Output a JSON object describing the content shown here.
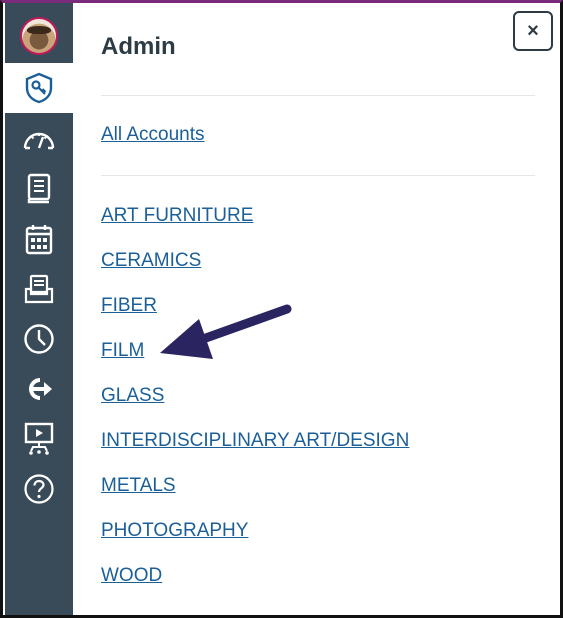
{
  "nav": {
    "items": [
      {
        "id": "avatar",
        "icon": "user-avatar"
      },
      {
        "id": "admin",
        "icon": "shield-key-icon",
        "active": true
      },
      {
        "id": "dashboard",
        "icon": "speedometer-icon"
      },
      {
        "id": "courses",
        "icon": "book-icon"
      },
      {
        "id": "calendar",
        "icon": "calendar-icon"
      },
      {
        "id": "inbox",
        "icon": "inbox-icon"
      },
      {
        "id": "history",
        "icon": "clock-icon"
      },
      {
        "id": "commons",
        "icon": "arrow-out-icon"
      },
      {
        "id": "studio",
        "icon": "presentation-icon"
      },
      {
        "id": "help",
        "icon": "help-icon"
      }
    ],
    "rail_color": "#394b58"
  },
  "panel": {
    "title": "Admin",
    "close_label": "×",
    "all_accounts": "All Accounts",
    "accounts": [
      "ART FURNITURE",
      "CERAMICS",
      "FIBER",
      "FILM",
      "GLASS",
      "INTERDISCIPLINARY ART/DESIGN",
      "METALS",
      "PHOTOGRAPHY",
      "WOOD"
    ],
    "link_color": "#1b5f99",
    "annotation_color": "#2a2460"
  }
}
